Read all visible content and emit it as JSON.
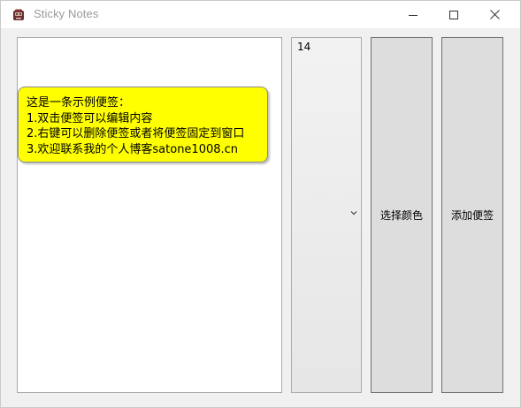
{
  "window": {
    "title": "Sticky Notes"
  },
  "titlebar": {
    "icons": {
      "app": "sticky-notes-app-icon",
      "minimize": "minimize-icon",
      "maximize": "maximize-icon",
      "close": "close-icon"
    }
  },
  "note": {
    "lines": [
      "这是一条示例便签：",
      "1.双击便签可以编辑内容",
      "2.右键可以删除便签或者将便签固定到窗口",
      "3.欢迎联系我的个人博客satone1008.cn"
    ],
    "background_color": "#ffff00"
  },
  "font_size_select": {
    "value": "14",
    "icon": "chevron-down-icon"
  },
  "buttons": {
    "choose_color": "选择颜色",
    "add_note": "添加便签"
  }
}
